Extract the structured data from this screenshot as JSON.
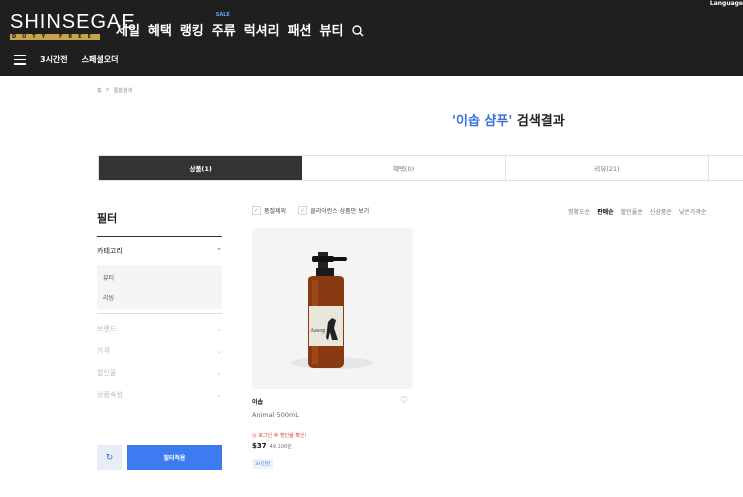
{
  "header": {
    "language": "Language",
    "logo_text": "SHINSEGAE",
    "logo_sub": "DUTY FREE",
    "nav": [
      "세일",
      "혜택",
      "랭킹",
      "주류",
      "럭셔리",
      "패션",
      "뷰티"
    ],
    "sale_tag": "SALE",
    "subnav": [
      "3시간전",
      "스페셜오더"
    ]
  },
  "breadcrumb": [
    "홈",
    ">",
    "통합검색"
  ],
  "search": {
    "keyword": "'이솝 샴푸'",
    "suffix": " 검색결과"
  },
  "tabs": [
    "상품(1)",
    "혜택(0)",
    "리뷰(21)",
    ""
  ],
  "filter": {
    "title": "필터",
    "category_label": "카테고리",
    "category_items": [
      "뷰티",
      "리빙"
    ],
    "collapsed": [
      "브랜드",
      "가격",
      "할인율",
      "상품속성"
    ],
    "apply_label": "필터적용"
  },
  "options": [
    "품절제외",
    "클리어런스 상품만 보기"
  ],
  "sort": [
    "정확도순",
    "판매순",
    "할인율순",
    "신상품순",
    "낮은가격순"
  ],
  "product": {
    "brand": "이솝",
    "name": "Animal 500mL",
    "promo": "로그인 후 할인율 확인!",
    "price_usd": "$37",
    "price_krw": "49,106원",
    "badge": "3시간전",
    "label_text": "Aesop"
  },
  "colors": {
    "header_bg": "#1f1f1f",
    "accent_blue": "#3d7bf0",
    "promo_red": "#e0452f"
  }
}
